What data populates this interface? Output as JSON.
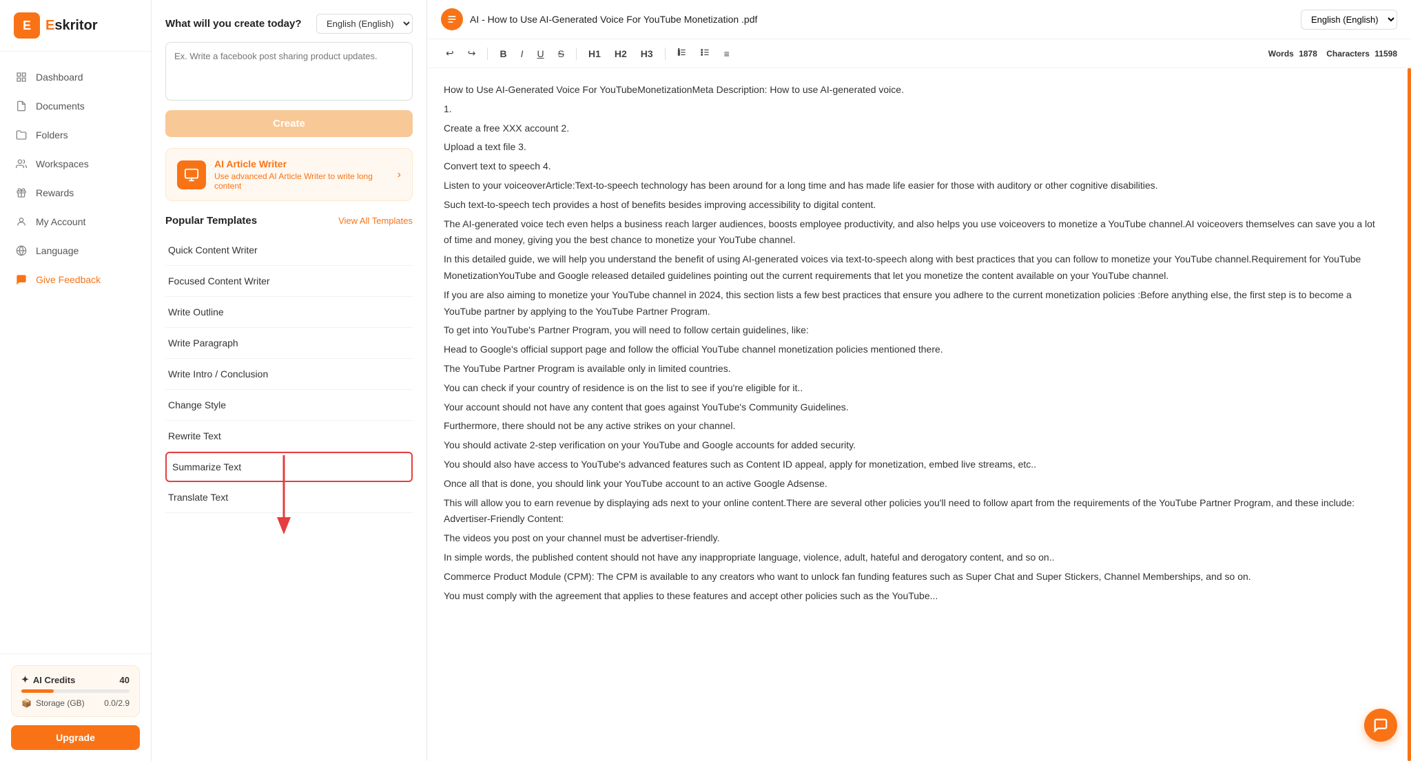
{
  "logo": {
    "icon": "E",
    "name": "skritor"
  },
  "sidebar": {
    "items": [
      {
        "id": "dashboard",
        "label": "Dashboard",
        "icon": "dashboard"
      },
      {
        "id": "documents",
        "label": "Documents",
        "icon": "documents"
      },
      {
        "id": "folders",
        "label": "Folders",
        "icon": "folders"
      },
      {
        "id": "workspaces",
        "label": "Workspaces",
        "icon": "workspaces"
      },
      {
        "id": "rewards",
        "label": "Rewards",
        "icon": "rewards"
      },
      {
        "id": "my-account",
        "label": "My Account",
        "icon": "my-account"
      },
      {
        "id": "language",
        "label": "Language",
        "icon": "language"
      },
      {
        "id": "give-feedback",
        "label": "Give Feedback",
        "icon": "give-feedback",
        "active": true
      }
    ],
    "credits": {
      "label": "AI Credits",
      "value": "40",
      "bar_percent": 30
    },
    "storage": {
      "label": "Storage (GB)",
      "value": "0.0/2.9"
    },
    "upgrade_button": "Upgrade"
  },
  "middle": {
    "create_title": "What will you create today?",
    "create_placeholder": "Ex. Write a facebook post sharing product updates.",
    "create_button": "Create",
    "language_select": "English (English)",
    "banner": {
      "title": "AI Article Writer",
      "description": "Use advanced AI Article Writer to write long content"
    },
    "templates_title": "Popular Templates",
    "view_all_link": "View All Templates",
    "templates": [
      {
        "id": "quick-content-writer",
        "label": "Quick Content Writer",
        "highlighted": false
      },
      {
        "id": "focused-content-writer",
        "label": "Focused Content Writer",
        "highlighted": false
      },
      {
        "id": "write-outline",
        "label": "Write Outline",
        "highlighted": false
      },
      {
        "id": "write-paragraph",
        "label": "Write Paragraph",
        "highlighted": false
      },
      {
        "id": "write-intro-conclusion",
        "label": "Write Intro / Conclusion",
        "highlighted": false
      },
      {
        "id": "change-style",
        "label": "Change Style",
        "highlighted": false
      },
      {
        "id": "rewrite-text",
        "label": "Rewrite Text",
        "highlighted": false
      },
      {
        "id": "summarize-text",
        "label": "Summarize Text",
        "highlighted": true
      },
      {
        "id": "translate-text",
        "label": "Translate Text",
        "highlighted": false
      }
    ]
  },
  "editor": {
    "doc_title": "AI - How to Use AI-Generated Voice For YouTube Monetization .pdf",
    "language_select": "English (English)",
    "toolbar": {
      "undo": "↩",
      "redo": "↪",
      "bold": "B",
      "italic": "I",
      "underline": "U",
      "strikethrough": "S",
      "h1": "H1",
      "h2": "H2",
      "h3": "H3",
      "ordered_list": "ol",
      "unordered_list": "ul",
      "align": "≡"
    },
    "word_count_label": "Words",
    "word_count": "1878",
    "char_count_label": "Characters",
    "char_count": "11598",
    "content": "How to Use AI-Generated Voice For YouTubeMonetizationMeta Description: How to use AI-generated voice.\n1.\nCreate a free XXX account 2.\nUpload a text file 3.\nConvert text to speech 4.\nListen to your voiceoverArticle:Text-to-speech technology has been around for a long time and has made life easier for those with auditory or other cognitive disabilities.\nSuch text-to-speech tech provides a host of benefits besides improving accessibility to digital content.\nThe AI-generated voice tech even helps a business reach larger audiences, boosts employee productivity, and also helps you use voiceovers to monetize a YouTube channel.AI voiceovers themselves can save you a lot of time and money, giving you the best chance to monetize your YouTube channel.\nIn this detailed guide, we will help you understand the benefit of using AI-generated voices via text-to-speech along with best practices that you can follow to monetize your YouTube channel.Requirement for YouTube MonetizationYouTube and Google released detailed guidelines pointing out the current requirements that let you monetize the content available on your YouTube channel.\nIf you are also aiming to monetize your YouTube channel in 2024, this section lists a few best practices that ensure you adhere to the current monetization policies :Before anything else, the first step is to become a YouTube partner by applying to the YouTube Partner Program.\nTo get into YouTube's Partner Program, you will need to follow certain guidelines, like:\nHead to Google's official support page and follow the official YouTube channel monetization policies mentioned there.\nThe YouTube Partner Program is available only in limited countries.\nYou can check if your country of residence is on the list to see if you're eligible for it..\nYour account should not have any content that goes against YouTube's Community Guidelines.\nFurthermore, there should not be any active strikes on your channel.\nYou should activate 2-step verification on your YouTube and Google accounts for added security.\nYou should also have access to YouTube's advanced features such as Content ID appeal, apply for monetization, embed live streams, etc..\nOnce all that is done, you should link your YouTube account to an active Google Adsense.\nThis will allow you to earn revenue by displaying ads next to your online content.There are several other policies you'll need to follow apart from the requirements of the YouTube Partner Program, and these include: Advertiser-Friendly Content:\nThe videos you post on your channel must be advertiser-friendly.\nIn simple words, the published content should not have any inappropriate language, violence, adult, hateful and derogatory content, and so on..\nCommerce Product Module (CPM): The CPM is available to any creators who want to unlock fan funding features such as Super Chat and Super Stickers, Channel Memberships, and so on.\nYou must comply with the agreement that applies to these features and accept other policies such as the YouTube..."
  }
}
